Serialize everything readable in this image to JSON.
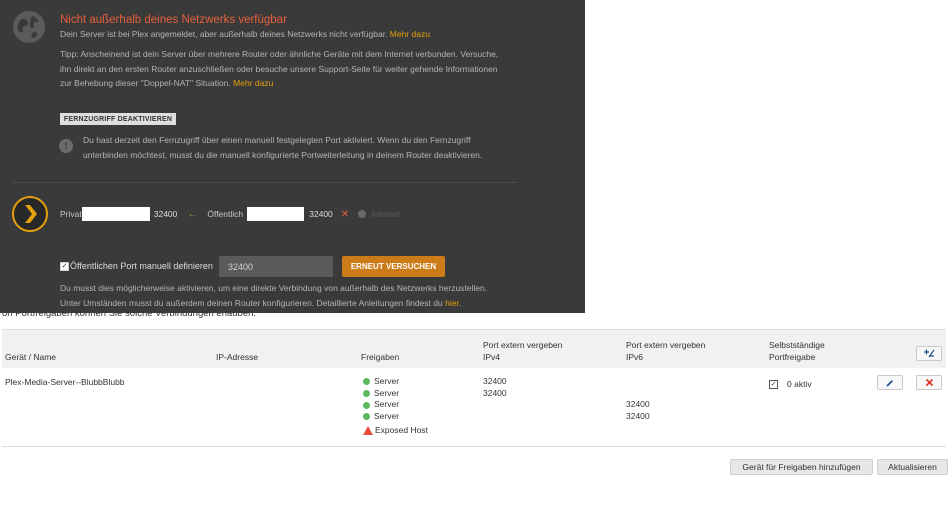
{
  "overlay": {
    "title": "Nicht außerhalb deines Netzwerks verfügbar",
    "line1_text": "Dein Server ist bei Plex angemeldet, aber außerhalb deines Netzwerks nicht verfügbar.",
    "line1_link": "Mehr dazu",
    "tip_line1": "Tipp: Anscheinend ist dein Server über mehrere Router oder ähnliche Geräte mit dem Internet verbunden. Versuche,",
    "tip_line2": "ihn direkt an den ersten Router anzuschließen oder besuche unsere Support-Seite für weiter gehende Informationen",
    "tip_line3": "zur Behebung dieser \"Doppel-NAT\" Situation.",
    "tip_link": "Mehr dazu",
    "disable_label": "FERNZUGRIFF DEAKTIVIEREN",
    "info_line1": "Du hast derzeit den Fernzugriff über einen manuell festgelegten Port aktiviert. Wenn du den Fernzugriff",
    "info_line2": "unterbinden möchtest, musst du die manuell konfigurierte Portweiterleitung in deinem Router deaktivieren.",
    "private_label": "Privat",
    "private_port": "32400",
    "public_label": "Öffentlich",
    "public_port": "32400",
    "internet_label": "Internet",
    "manual_port_label": "Öffentlichen Port manuell definieren",
    "manual_port_value": "32400",
    "retry_label": "ERNEUT VERSUCHEN",
    "hint_line1": "Du musst dies möglicherweise aktivieren, um eine direkte Verbindung von außerhalb des Netzwerks herzustellen.",
    "hint_line2": "Unter Umständen musst du außerdem deinen Router konfigurieren. Detaillierte Anleitungen findest du",
    "hint_link": "hier",
    "colors": {
      "accent": "#e5a00d",
      "error_title": "#e5603c",
      "panel": "#3a3a3a"
    }
  },
  "background": {
    "clipped_text": "on Portfreigaben können Sie solche Verbindungen erlauben.",
    "table": {
      "headers": {
        "device": "Gerät / Name",
        "ip": "IP-Adresse",
        "shares": "Freigaben",
        "ipv4_line1": "Port extern vergeben",
        "ipv4_line2": "IPv4",
        "ipv6_line1": "Port extern vergeben",
        "ipv6_line2": "IPv6",
        "self_line1": "Selbstständige",
        "self_line2": "Portfreigabe"
      },
      "row": {
        "device": "Plex-Media-Server--BlubbBlubb",
        "shares": [
          "Server",
          "Server",
          "Server",
          "Server"
        ],
        "exposed_host": "Exposed Host",
        "ipv4": [
          "32400",
          "32400",
          "",
          ""
        ],
        "ipv6": [
          "",
          "",
          "32400",
          "32400"
        ],
        "self_share": "0 aktiv"
      }
    },
    "add_device_button": "Gerät für Freigaben hinzufügen",
    "refresh_button": "Aktualisieren"
  }
}
